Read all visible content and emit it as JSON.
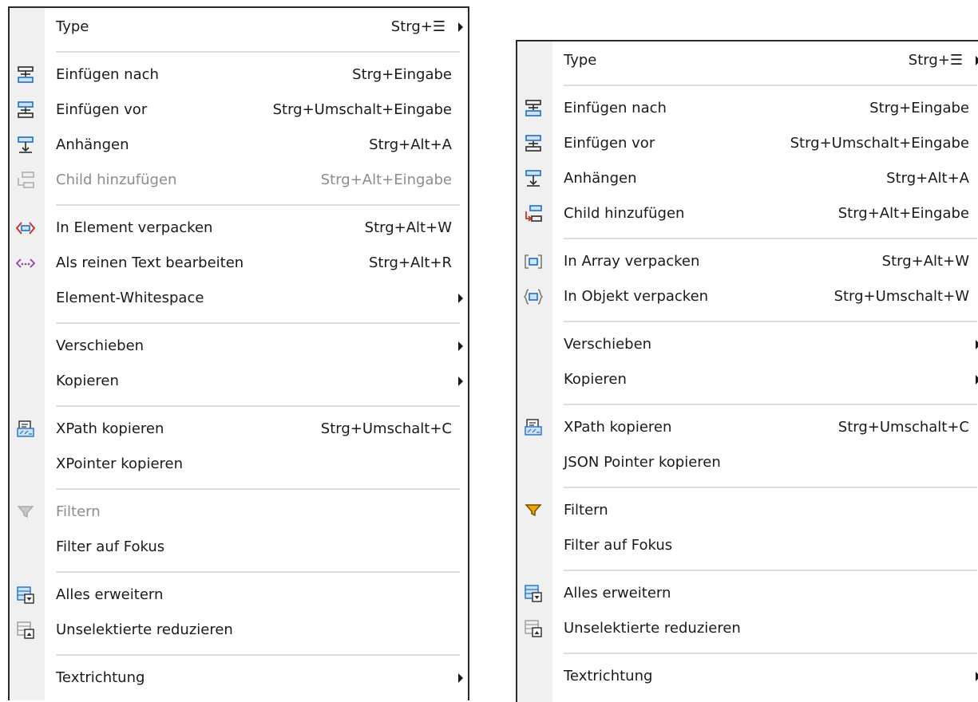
{
  "left_menu": {
    "items": [
      {
        "label": "Type",
        "shortcut": "Strg+☰"
      },
      {
        "label": "Einfügen nach",
        "shortcut": "Strg+Eingabe"
      },
      {
        "label": "Einfügen vor",
        "shortcut": "Strg+Umschalt+Eingabe"
      },
      {
        "label": "Anhängen",
        "shortcut": "Strg+Alt+A"
      },
      {
        "label": "Child hinzufügen",
        "shortcut": "Strg+Alt+Eingabe"
      },
      {
        "label": "In Element verpacken",
        "shortcut": "Strg+Alt+W"
      },
      {
        "label": "Als reinen Text bearbeiten",
        "shortcut": "Strg+Alt+R"
      },
      {
        "label": "Element-Whitespace",
        "shortcut": ""
      },
      {
        "label": "Verschieben",
        "shortcut": ""
      },
      {
        "label": "Kopieren",
        "shortcut": ""
      },
      {
        "label": "XPath kopieren",
        "shortcut": "Strg+Umschalt+C"
      },
      {
        "label": "XPointer kopieren",
        "shortcut": ""
      },
      {
        "label": "Filtern",
        "shortcut": ""
      },
      {
        "label": "Filter auf Fokus",
        "shortcut": ""
      },
      {
        "label": "Alles erweitern",
        "shortcut": ""
      },
      {
        "label": "Unselektierte reduzieren",
        "shortcut": ""
      },
      {
        "label": "Textrichtung",
        "shortcut": ""
      }
    ]
  },
  "right_menu": {
    "items": [
      {
        "label": "Type",
        "shortcut": "Strg+☰"
      },
      {
        "label": "Einfügen nach",
        "shortcut": "Strg+Eingabe"
      },
      {
        "label": "Einfügen vor",
        "shortcut": "Strg+Umschalt+Eingabe"
      },
      {
        "label": "Anhängen",
        "shortcut": "Strg+Alt+A"
      },
      {
        "label": "Child hinzufügen",
        "shortcut": "Strg+Alt+Eingabe"
      },
      {
        "label": "In Array verpacken",
        "shortcut": "Strg+Alt+W"
      },
      {
        "label": "In Objekt verpacken",
        "shortcut": "Strg+Umschalt+W"
      },
      {
        "label": "Verschieben",
        "shortcut": ""
      },
      {
        "label": "Kopieren",
        "shortcut": ""
      },
      {
        "label": "XPath kopieren",
        "shortcut": "Strg+Umschalt+C"
      },
      {
        "label": "JSON Pointer kopieren",
        "shortcut": ""
      },
      {
        "label": "Filtern",
        "shortcut": ""
      },
      {
        "label": "Filter auf Fokus",
        "shortcut": ""
      },
      {
        "label": "Alles erweitern",
        "shortcut": ""
      },
      {
        "label": "Unselektierte reduzieren",
        "shortcut": ""
      },
      {
        "label": "Textrichtung",
        "shortcut": ""
      }
    ]
  },
  "colors": {
    "accent_blue": "#1e6fc8",
    "icon_dark": "#2a2a2a",
    "wrap_red": "#c0392b",
    "purple": "#8e44ad",
    "filter_orange": "#f0a500",
    "disabled_gray": "#8c8c8c"
  },
  "icons": {
    "insert_after": "insert-after-icon",
    "insert_before": "insert-before-icon",
    "append": "append-icon",
    "add_child": "add-child-icon",
    "wrap_element": "wrap-element-icon",
    "edit_text": "edit-as-text-icon",
    "wrap_array": "wrap-array-icon",
    "wrap_object": "wrap-object-icon",
    "copy_xpath": "copy-xpath-icon",
    "filter": "filter-icon",
    "expand_all": "expand-all-icon",
    "collapse_unselected": "collapse-unselected-icon"
  }
}
